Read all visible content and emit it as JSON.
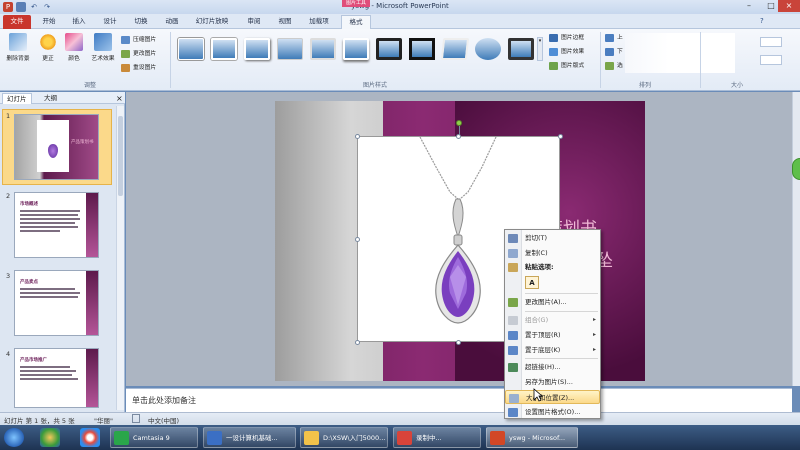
{
  "window": {
    "title": "yswg - Microsoft PowerPoint"
  },
  "context_tab": {
    "label": "图片工具"
  },
  "tabs": [
    "文件",
    "开始",
    "插入",
    "设计",
    "切换",
    "动画",
    "幻灯片放映",
    "审阅",
    "视图",
    "加载项",
    "格式"
  ],
  "ribbon": {
    "adjust": {
      "remove_bg": "删除背景",
      "corrections": "更正",
      "color": "颜色",
      "artistic": "艺术效果",
      "compress": "压缩图片",
      "change": "更改图片",
      "reset": "重设图片",
      "group_label": "调整"
    },
    "styles": {
      "border": "图片边框",
      "effects": "图片效果",
      "layout": "图片版式",
      "group_label": "图片样式"
    },
    "arrange": {
      "bring_forward": "上",
      "send_backward": "下",
      "selection": "选",
      "group_label": "排列"
    },
    "size": {
      "group_label": "大小"
    }
  },
  "left_panel": {
    "tabs": [
      "幻灯片",
      "大纲"
    ],
    "close": "×",
    "slides": [
      {
        "num": "1",
        "title": "产品策划书"
      },
      {
        "num": "2",
        "title": "市场概述"
      },
      {
        "num": "3",
        "title": "产品卖点"
      },
      {
        "num": "4",
        "title": "产品市场推广"
      }
    ]
  },
  "slide": {
    "title_line1": "策划书",
    "title_line2": "坠"
  },
  "notes": {
    "placeholder": "单击此处添加备注"
  },
  "status": {
    "slide_info": "幻灯片 第 1 张，共 5 张",
    "theme": "\"华丽\"",
    "language": "中文(中国)"
  },
  "context_menu": {
    "items": [
      {
        "label": "剪切(T)",
        "icon": "scissors-icon",
        "enabled": true
      },
      {
        "label": "复制(C)",
        "icon": "copy-icon",
        "enabled": true
      },
      {
        "label": "粘贴选项:",
        "icon": "paste-icon",
        "enabled": true,
        "bold": true
      },
      {
        "label": "A",
        "icon": "",
        "enabled": true
      },
      {
        "label": "更改图片(A)...",
        "icon": "change-picture-icon",
        "enabled": true
      },
      {
        "label": "组合(G)",
        "icon": "group-icon",
        "enabled": false,
        "submenu": true
      },
      {
        "label": "置于顶层(R)",
        "icon": "bring-front-icon",
        "enabled": true,
        "submenu": true
      },
      {
        "label": "置于底层(K)",
        "icon": "send-back-icon",
        "enabled": true,
        "submenu": true
      },
      {
        "label": "超链接(H)...",
        "icon": "hyperlink-icon",
        "enabled": true
      },
      {
        "label": "另存为图片(S)...",
        "icon": "",
        "enabled": true
      },
      {
        "label": "大小和位置(Z)...",
        "icon": "size-position-icon",
        "enabled": true,
        "highlighted": true
      },
      {
        "label": "设置图片格式(O)...",
        "icon": "format-picture-icon",
        "enabled": true
      }
    ]
  },
  "taskbar": {
    "items": [
      {
        "label": "Camtasia 9"
      },
      {
        "label": "一设计算机基础..."
      },
      {
        "label": "D:\\XSW\\入门5000..."
      },
      {
        "label": "录制中..."
      },
      {
        "label": "yswg - Microsof..."
      }
    ]
  },
  "colors": {
    "file_tab": "#c9352c",
    "slide_bg": "#7a1f63",
    "context_accent": "#e04d7a",
    "menu_highlight": "#fbd98a"
  }
}
